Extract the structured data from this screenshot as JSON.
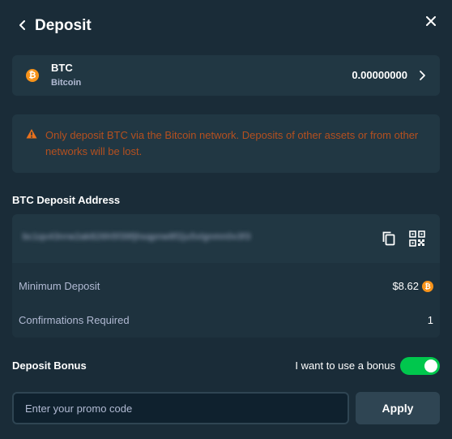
{
  "header": {
    "title": "Deposit",
    "back_icon": "chevron-left-icon",
    "close_icon": "close-icon"
  },
  "currency": {
    "code": "BTC",
    "name": "Bitcoin",
    "balance": "0.00000000",
    "icon": "bitcoin-icon",
    "icon_glyph": "₿",
    "color": "#f7931a"
  },
  "warning": {
    "icon": "warning-icon",
    "text": "Only deposit BTC via the Bitcoin network. Deposits of other assets or from other networks will be lost.",
    "color": "#b5501f"
  },
  "deposit_address": {
    "label": "BTC Deposit Address",
    "value": "bc1qx43nrw2ak826h5f39fjhsqpnw8f2ju5xlgnmn0v3f3",
    "copy_icon": "copy-icon",
    "qr_icon": "qr-code-icon"
  },
  "info": {
    "minimum_deposit_label": "Minimum Deposit",
    "minimum_deposit_value": "$8.62",
    "minimum_deposit_icon_glyph": "₿",
    "confirmations_label": "Confirmations Required",
    "confirmations_value": "1"
  },
  "bonus": {
    "label": "Deposit Bonus",
    "toggle_label": "I want to use a bonus",
    "toggle_on": true,
    "toggle_color": "#00c74d"
  },
  "promo": {
    "placeholder": "Enter your promo code",
    "value": "",
    "apply_label": "Apply"
  }
}
